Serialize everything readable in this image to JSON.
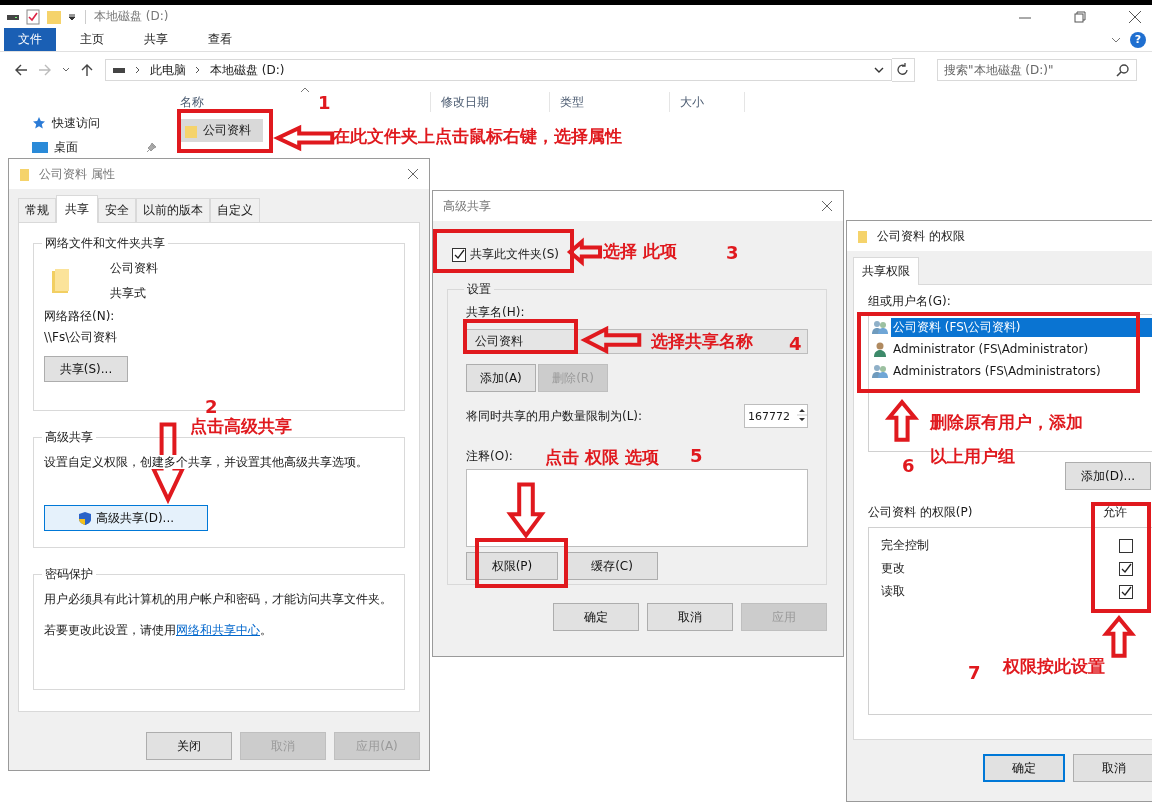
{
  "explorer": {
    "title": "本地磁盘 (D:)",
    "ribbon_tabs": [
      {
        "label": "文件",
        "kind": "file"
      },
      {
        "label": "主页",
        "kind": "tab"
      },
      {
        "label": "共享",
        "kind": "tab"
      },
      {
        "label": "查看",
        "kind": "tab"
      }
    ],
    "help": "?",
    "breadcrumb": [
      "此电脑",
      "本地磁盘 (D:)"
    ],
    "search": {
      "placeholder": "搜索\"本地磁盘 (D:)\""
    },
    "nav_items": [
      {
        "label": "快速访问",
        "kind": "star"
      },
      {
        "label": "桌面",
        "kind": "desktop"
      }
    ],
    "columns": [
      "名称",
      "修改日期",
      "类型",
      "大小"
    ],
    "files": [
      {
        "name": "公司资料",
        "selected": true
      }
    ]
  },
  "properties_dialog": {
    "title": "公司资料 属性",
    "tabs": [
      {
        "label": "常规",
        "selected": false
      },
      {
        "label": "共享",
        "selected": true
      },
      {
        "label": "安全",
        "selected": false
      },
      {
        "label": "以前的版本",
        "selected": false
      },
      {
        "label": "自定义",
        "selected": false
      }
    ],
    "network_group": {
      "title": "网络文件和文件夹共享",
      "folder_name": "公司资料",
      "folder_state": "共享式",
      "path_label": "网络路径(N):",
      "path": "\\\\Fs\\公司资料",
      "button": "共享(S)..."
    },
    "advanced_group": {
      "title": "高级共享",
      "description": "设置自定义权限，创建多个共享，并设置其他高级共享选项。",
      "button": "高级共享(D)..."
    },
    "password_group": {
      "title": "密码保护",
      "text": "用户必须具有此计算机的用户帐户和密码，才能访问共享文件夹。",
      "change_before": "若要更改此设置，请使用",
      "link": "网络和共享中心",
      "change_after": "。"
    },
    "buttons": [
      {
        "label": "关闭",
        "disabled": false
      },
      {
        "label": "取消",
        "disabled": true
      },
      {
        "label": "应用(A)",
        "disabled": true
      }
    ]
  },
  "advanced_dialog": {
    "title": "高级共享",
    "share_checkbox": {
      "label": "共享此文件夹(S)",
      "checked": true
    },
    "settings_title": "设置",
    "share_name_label": "共享名(H):",
    "share_name": "公司资料",
    "name_buttons": [
      {
        "label": "添加(A)",
        "disabled": false
      },
      {
        "label": "删除(R)",
        "disabled": true
      }
    ],
    "limit_label": "将同时共享的用户数量限制为(L):",
    "limit_value": "167772",
    "comment_label": "注释(O):",
    "option_buttons": [
      {
        "label": "权限(P)",
        "disabled": false
      },
      {
        "label": "缓存(C)",
        "disabled": false
      }
    ],
    "buttons": [
      {
        "label": "确定",
        "disabled": false
      },
      {
        "label": "取消",
        "disabled": false
      },
      {
        "label": "应用",
        "disabled": true
      }
    ]
  },
  "permissions_dialog": {
    "title": "公司资料 的权限",
    "tab": {
      "label": "共享权限",
      "selected": true
    },
    "group_label": "组或用户名(G):",
    "users": [
      {
        "name": "公司资料 (FS\\公司资料)",
        "kind": "group",
        "selected": true
      },
      {
        "name": "Administrator (FS\\Administrator)",
        "kind": "user",
        "selected": false
      },
      {
        "name": "Administrators (FS\\Administrators)",
        "kind": "group",
        "selected": false
      }
    ],
    "add_button": "添加(D)...",
    "permissions_label": "公司资料 的权限(P)",
    "allow_header": "允许",
    "permissions": [
      {
        "name": "完全控制",
        "allow": false
      },
      {
        "name": "更改",
        "allow": true
      },
      {
        "name": "读取",
        "allow": true
      }
    ],
    "buttons": [
      "确定",
      "取消"
    ]
  },
  "annotations": [
    {
      "number": "1",
      "texts": [
        "在此文件夹上点击鼠标右键，选择属性"
      ]
    },
    {
      "number": "2",
      "texts": [
        "点击高级共享"
      ]
    },
    {
      "number": "3",
      "texts": [
        "选择 此项"
      ]
    },
    {
      "number": "4",
      "texts": [
        "选择共享名称"
      ]
    },
    {
      "number": "5",
      "texts": [
        "点击 权限 选项"
      ]
    },
    {
      "number": "6",
      "texts": [
        "删除原有用户，添加",
        "以上用户组"
      ]
    },
    {
      "number": "7",
      "texts": [
        "权限按此设置"
      ]
    }
  ]
}
